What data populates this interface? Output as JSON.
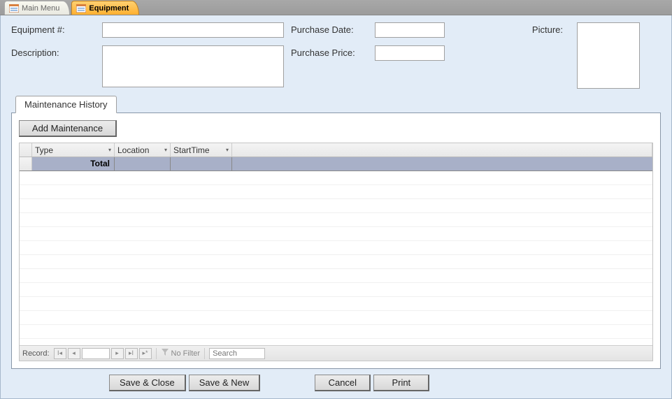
{
  "tabs": {
    "main_menu": "Main Menu",
    "equipment": "Equipment"
  },
  "fields": {
    "equipment_num_label": "Equipment #:",
    "equipment_num_value": "",
    "description_label": "Description:",
    "description_value": "",
    "purchase_date_label": "Purchase Date:",
    "purchase_date_value": "",
    "purchase_price_label": "Purchase Price:",
    "purchase_price_value": "",
    "picture_label": "Picture:"
  },
  "subtab": {
    "maintenance_history": "Maintenance History"
  },
  "subform": {
    "add_maintenance": "Add Maintenance",
    "columns": {
      "type": "Type",
      "location": "Location",
      "start_time": "StartTime"
    },
    "total_label": "Total"
  },
  "record_nav": {
    "label": "Record:",
    "current": "",
    "no_filter": "No Filter",
    "search_placeholder": "Search"
  },
  "buttons": {
    "save_close": "Save & Close",
    "save_new": "Save & New",
    "cancel": "Cancel",
    "print": "Print"
  }
}
